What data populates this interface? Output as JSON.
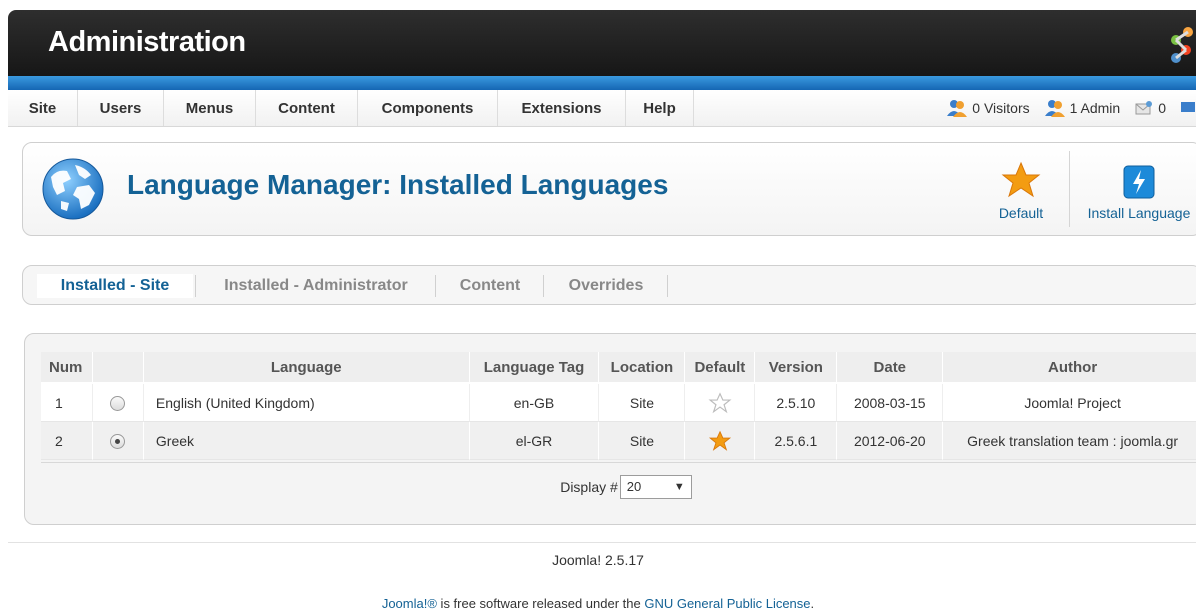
{
  "header": {
    "title": "Administration"
  },
  "menu": {
    "items": [
      {
        "label": "Site"
      },
      {
        "label": "Users"
      },
      {
        "label": "Menus"
      },
      {
        "label": "Content"
      },
      {
        "label": "Components"
      },
      {
        "label": "Extensions"
      },
      {
        "label": "Help"
      }
    ],
    "status": {
      "visitors": "0 Visitors",
      "admin": "1 Admin",
      "messages": "0"
    }
  },
  "toolbar": {
    "page_title": "Language Manager: Installed Languages",
    "default_label": "Default",
    "install_label": "Install Language"
  },
  "subtabs": [
    {
      "label": "Installed - Site"
    },
    {
      "label": "Installed - Administrator"
    },
    {
      "label": "Content"
    },
    {
      "label": "Overrides"
    }
  ],
  "table": {
    "columns": [
      "Num",
      "",
      "Language",
      "Language Tag",
      "Location",
      "Default",
      "Version",
      "Date",
      "Author"
    ],
    "rows": [
      {
        "num": "1",
        "selected": false,
        "language": "English (United Kingdom)",
        "tag": "en-GB",
        "location": "Site",
        "default": false,
        "version": "2.5.10",
        "date": "2008-03-15",
        "author": "Joomla! Project"
      },
      {
        "num": "2",
        "selected": true,
        "language": "Greek",
        "tag": "el-GR",
        "location": "Site",
        "default": true,
        "version": "2.5.6.1",
        "date": "2012-06-20",
        "author": "Greek translation team : joomla.gr"
      }
    ]
  },
  "pager": {
    "display_label": "Display #",
    "display_value": "20"
  },
  "footer": {
    "version": "Joomla! 2.5.17",
    "license_prefix": "Joomla!®",
    "license_mid": " is free software released under the ",
    "license_link": "GNU General Public License",
    "license_suffix": "."
  },
  "colors": {
    "accent": "#146295",
    "header_bar": "#1a1a1a",
    "blue_strip": "#2a84cf",
    "star": "#f39c12"
  }
}
